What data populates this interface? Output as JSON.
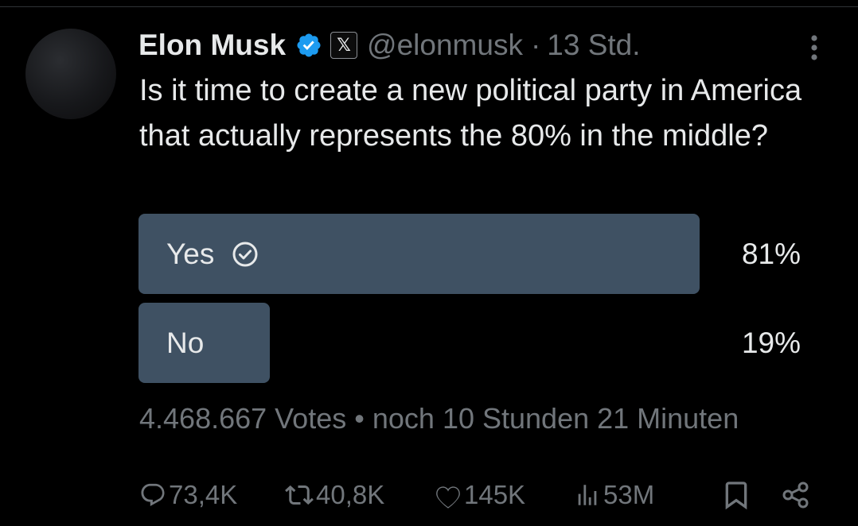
{
  "tweet": {
    "author": {
      "display_name": "Elon Musk",
      "handle": "@elonmusk",
      "affiliate_badge_text": "𝕏"
    },
    "dot_separator": "·",
    "time": "13 Std.",
    "text": "Is it time to create a new political party in America that actually represents the 80% in the middle?"
  },
  "poll": {
    "options": [
      {
        "label": "Yes",
        "percent_text": "81%",
        "percent": 81,
        "winner": true
      },
      {
        "label": "No",
        "percent_text": "19%",
        "percent": 19,
        "winner": false
      }
    ],
    "votes": "4.468.667 Votes",
    "bullet": "•",
    "time_left": "noch 10 Stunden 21 Minuten"
  },
  "actions": {
    "replies": "73,4K",
    "reposts": "40,8K",
    "likes": "145K",
    "views": "53M"
  },
  "icons": {
    "verified": "verified-badge-icon",
    "more": "more-vertical-icon",
    "winner_check": "check-circle-icon",
    "reply": "reply-icon",
    "repost": "repost-icon",
    "like": "heart-icon",
    "views": "views-icon",
    "bookmark": "bookmark-icon",
    "share": "share-icon"
  },
  "colors": {
    "background": "#000000",
    "text_primary": "#e7e9ea",
    "text_secondary": "#71767b",
    "verified_blue": "#1d9bf0",
    "poll_bar": "#3f5163"
  }
}
